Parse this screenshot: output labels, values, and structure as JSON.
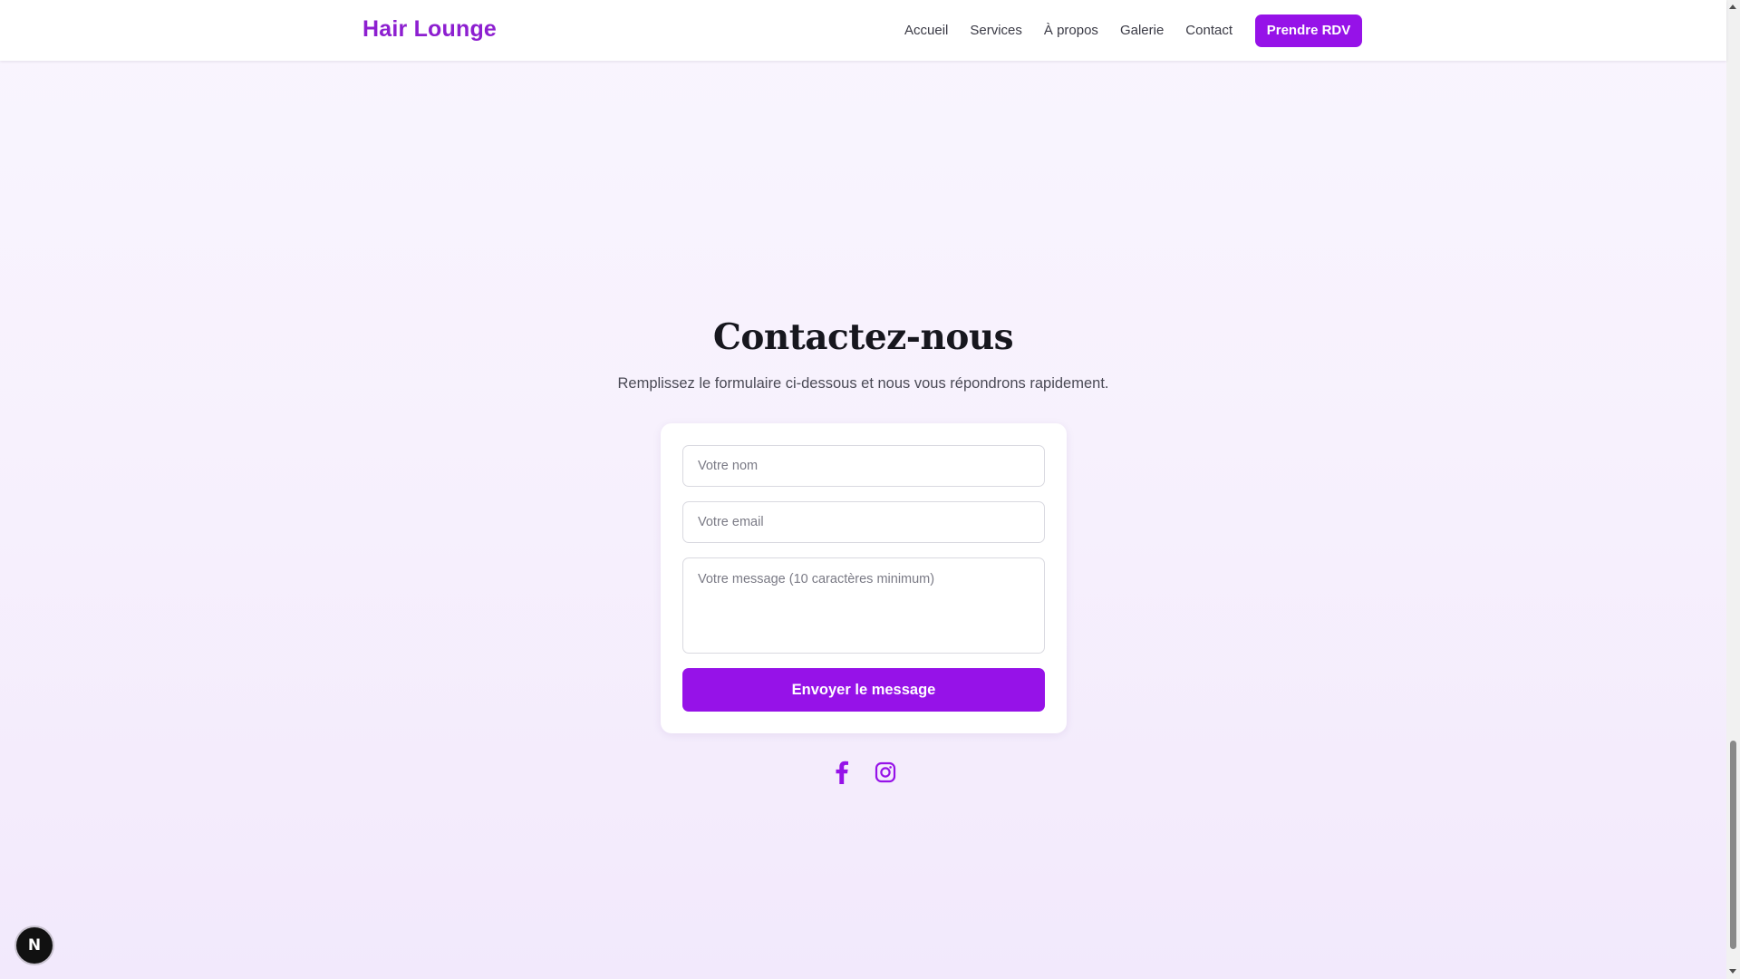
{
  "header": {
    "logo": "Hair Lounge",
    "nav": [
      {
        "label": "Accueil"
      },
      {
        "label": "Services"
      },
      {
        "label": "À propos"
      },
      {
        "label": "Galerie"
      },
      {
        "label": "Contact"
      }
    ],
    "cta_label": "Prendre RDV"
  },
  "contact": {
    "title": "Contactez-nous",
    "subtitle": "Remplissez le formulaire ci-dessous et nous vous répondrons rapidement.",
    "form": {
      "name_placeholder": "Votre nom",
      "name_value": "",
      "email_placeholder": "Votre email",
      "email_value": "",
      "message_placeholder": "Votre message (10 caractères minimum)",
      "message_value": "",
      "submit_label": "Envoyer le message"
    },
    "socials": [
      {
        "icon": "facebook-icon"
      },
      {
        "icon": "instagram-icon"
      }
    ]
  },
  "dev_badge": {
    "letter": "N"
  },
  "colors": {
    "brand": "#9612e8",
    "logo": "#8d1fd0",
    "background": "#f7f1fd"
  }
}
